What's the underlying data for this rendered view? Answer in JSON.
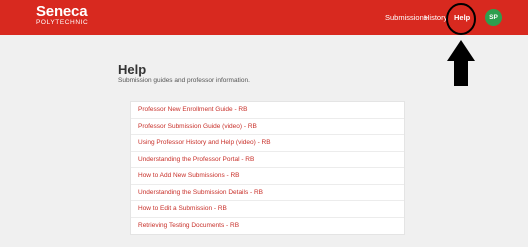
{
  "header": {
    "logo_main": "Seneca",
    "logo_sub": "POLYTECHNIC",
    "nav": {
      "submissions": "Submissions",
      "history": "History",
      "help": "Help"
    },
    "avatar_initials": "SP"
  },
  "colors": {
    "brand_red": "#d8291f",
    "avatar_green": "#2e9e4e",
    "link_red": "#c8302a"
  },
  "page": {
    "title": "Help",
    "subtitle": "Submission guides and professor information."
  },
  "guides": [
    "Professor New Enrollment Guide - RB",
    "Professor Submission Guide (video) - RB",
    "Using Professor History and Help (video) - RB",
    "Understanding the Professor Portal - RB",
    "How to Add New Submissions - RB",
    "Understanding the Submission Details - RB",
    "How to Edit a Submission - RB",
    "Retrieving Testing Documents - RB"
  ]
}
